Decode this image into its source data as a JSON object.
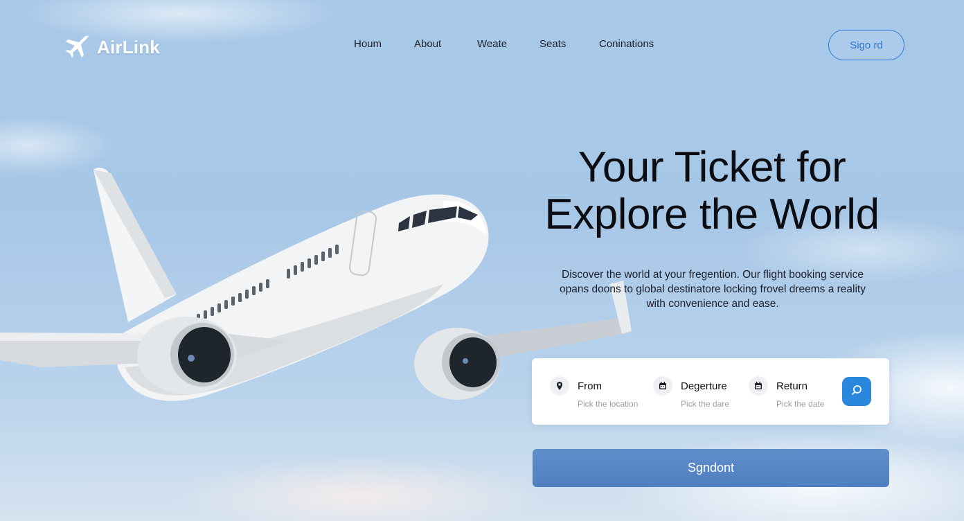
{
  "brand": {
    "name": "AirLink",
    "icon": "airplane-icon"
  },
  "nav": {
    "items": [
      {
        "label": "Houm"
      },
      {
        "label": "About"
      },
      {
        "label": "Weate"
      },
      {
        "label": "Seats"
      },
      {
        "label": "Coninations"
      }
    ],
    "signin_label": "Sigo rd"
  },
  "hero": {
    "title_line1": "Your Ticket for",
    "title_line2": "Explore the World",
    "desc_line1": "Discover the world at your fregention. Our flight booking service",
    "desc_line2": "opans doons to global destinatore locking frovel dreems a reality",
    "desc_line3": "with convenience and ease."
  },
  "search": {
    "from": {
      "label": "From",
      "placeholder": "Pick the location",
      "icon": "location-pin-icon"
    },
    "departure": {
      "label": "Degerture",
      "placeholder": "Pick the dare",
      "icon": "calendar-icon"
    },
    "return": {
      "label": "Return",
      "placeholder": "Pick the date",
      "icon": "calendar-icon"
    },
    "button_icon": "search-icon"
  },
  "submit_label": "Sgndont",
  "colors": {
    "accent": "#2f79d0",
    "search_button": "#2a87de",
    "submit_button": "#5687c6",
    "sky": "#a9c9e9"
  }
}
